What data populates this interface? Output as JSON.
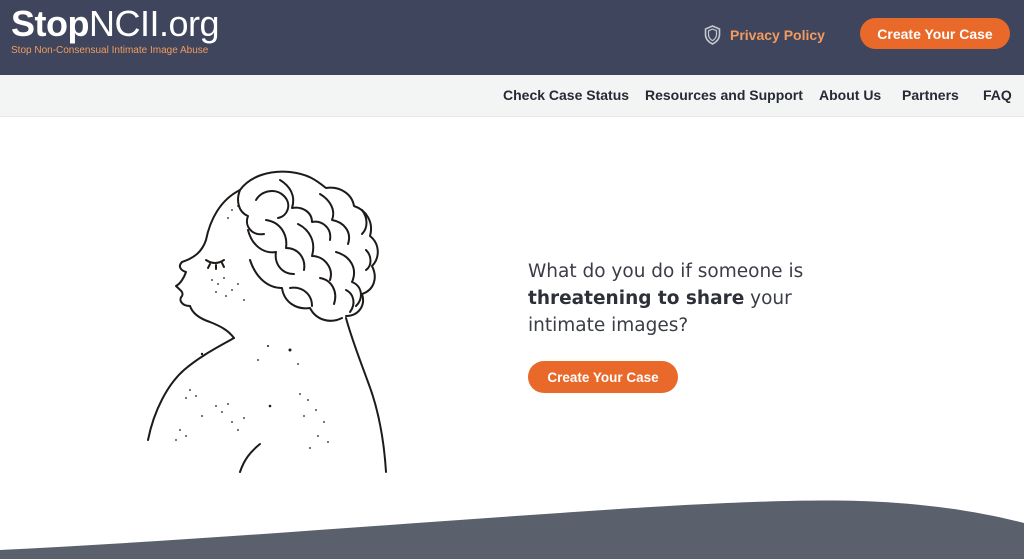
{
  "header": {
    "logo_bold": "Stop",
    "logo_regular": "NCII.org",
    "tagline": "Stop Non-Consensual Intimate Image Abuse",
    "privacy_label": "Privacy Policy",
    "create_case_label": "Create Your Case"
  },
  "nav": {
    "items": [
      {
        "label": "Check Case Status"
      },
      {
        "label": "Resources and Support"
      },
      {
        "label": "About Us"
      },
      {
        "label": "Partners"
      },
      {
        "label": "FAQ"
      }
    ]
  },
  "hero": {
    "line1": "What do you do if someone is",
    "bold": "threatening to share",
    "line2_rest": " your",
    "line3": "intimate images?",
    "cta_label": "Create Your Case"
  },
  "colors": {
    "header_bg": "#3e455c",
    "accent_orange": "#e8692a",
    "nav_bg": "#f3f4f4",
    "footer_wave": "#5b606d"
  },
  "icons": {
    "privacy": "shield-icon"
  }
}
